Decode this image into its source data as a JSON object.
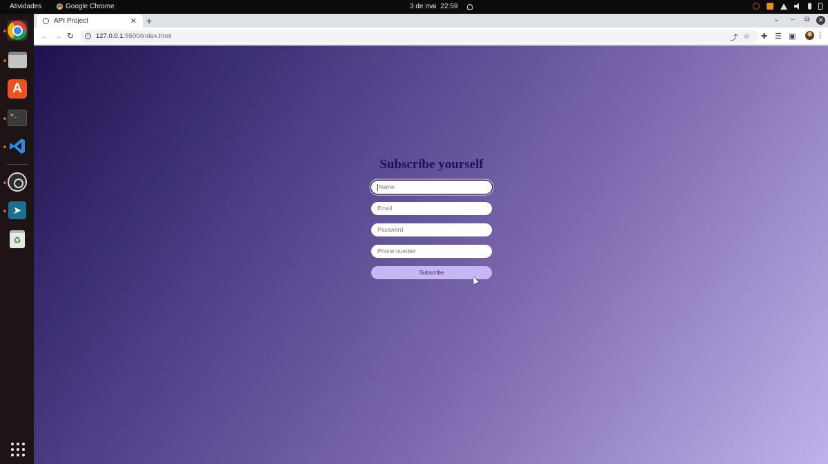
{
  "system_bar": {
    "activities": "Atividades",
    "app_name": "Google Chrome",
    "date": "3 de mai",
    "time": "22:59"
  },
  "dock": {
    "items": [
      "chrome-icon",
      "files-icon",
      "app-store-icon",
      "terminal-icon",
      "vscode-icon",
      "obs-icon",
      "send-app-icon",
      "trash-icon"
    ],
    "show_apps": "apps-grid-icon"
  },
  "browser": {
    "tab_title": "API Project",
    "new_tab": "+",
    "url_host": "127.0.0.1",
    "url_rest": ":5500/index.html"
  },
  "page": {
    "title": "Subscribe yourself",
    "fields": [
      {
        "placeholder": "Name"
      },
      {
        "placeholder": "Email"
      },
      {
        "placeholder": "Password"
      },
      {
        "placeholder": "Phone number"
      }
    ],
    "submit_label": "Subscribe",
    "colors": {
      "gradient_start": "#1f1150",
      "gradient_end": "#c0b1ec",
      "title": "#220f5a",
      "button": "#c7b6f4"
    }
  }
}
